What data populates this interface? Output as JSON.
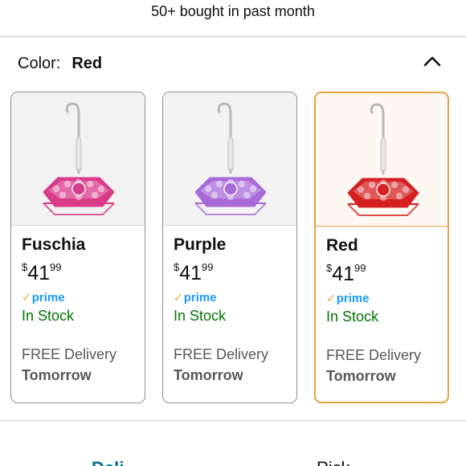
{
  "header": {
    "bought_text": "50+ bought in past month"
  },
  "color_selector": {
    "label": "Color:",
    "selected_value": "Red",
    "expanded": true
  },
  "colors": {
    "accent_selected_border": "#e3a245",
    "in_stock": "#007600",
    "prime": "#1a98ff"
  },
  "variants": [
    {
      "name": "Fuschia",
      "price_symbol": "$",
      "price_whole": "41",
      "price_fraction": "99",
      "prime": "prime",
      "stock": "In Stock",
      "delivery": "FREE Delivery",
      "delivery_day": "Tomorrow",
      "feeder_color": "#d93a8a",
      "selected": false
    },
    {
      "name": "Purple",
      "price_symbol": "$",
      "price_whole": "41",
      "price_fraction": "99",
      "prime": "prime",
      "stock": "In Stock",
      "delivery": "FREE Delivery",
      "delivery_day": "Tomorrow",
      "feeder_color": "#a86ad8",
      "selected": false
    },
    {
      "name": "Red",
      "price_symbol": "$",
      "price_whole": "41",
      "price_fraction": "99",
      "prime": "prime",
      "stock": "In Stock",
      "delivery": "FREE Delivery",
      "delivery_day": "Tomorrow",
      "feeder_color": "#d42020",
      "selected": true
    }
  ],
  "bottom_tabs": {
    "delivery": "Deli",
    "pickup": "Pick"
  }
}
